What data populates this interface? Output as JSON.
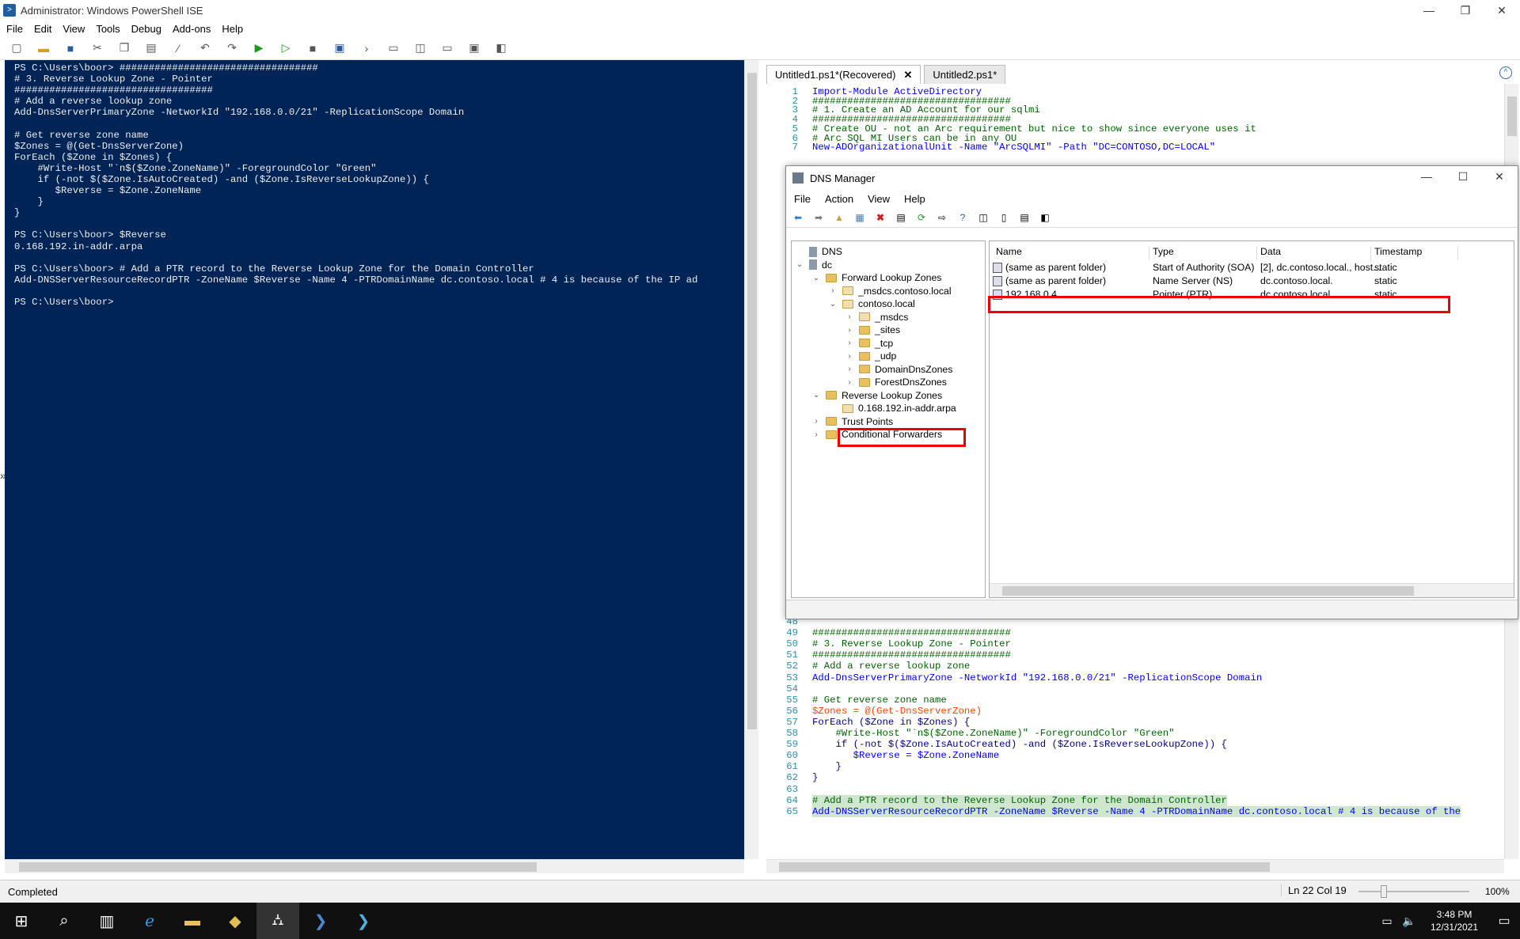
{
  "window": {
    "title": "Administrator: Windows PowerShell ISE",
    "minimize": "—",
    "restore": "❐",
    "close": "✕"
  },
  "menu": [
    "File",
    "Edit",
    "View",
    "Tools",
    "Debug",
    "Add-ons",
    "Help"
  ],
  "console": {
    "lines": [
      "PS C:\\Users\\boor> ##################################",
      "# 3. Reverse Lookup Zone - Pointer",
      "##################################",
      "# Add a reverse lookup zone",
      "Add-DnsServerPrimaryZone -NetworkId \"192.168.0.0/21\" -ReplicationScope Domain",
      "",
      "# Get reverse zone name",
      "$Zones = @(Get-DnsServerZone)",
      "ForEach ($Zone in $Zones) {",
      "    #Write-Host \"`n$($Zone.ZoneName)\" -ForegroundColor \"Green\"",
      "    if (-not $($Zone.IsAutoCreated) -and ($Zone.IsReverseLookupZone)) {",
      "       $Reverse = $Zone.ZoneName",
      "    }",
      "}",
      "",
      "PS C:\\Users\\boor> $Reverse",
      "0.168.192.in-addr.arpa",
      "",
      "PS C:\\Users\\boor> # Add a PTR record to the Reverse Lookup Zone for the Domain Controller",
      "Add-DNSServerResourceRecordPTR -ZoneName $Reverse -Name 4 -PTRDomainName dc.contoso.local # 4 is because of the IP ad",
      "",
      "PS C:\\Users\\boor>"
    ]
  },
  "tabs": [
    {
      "label": "Untitled1.ps1*(Recovered)",
      "close": "✕"
    },
    {
      "label": "Untitled2.ps1*"
    }
  ],
  "editor_top": [
    {
      "n": "1",
      "t": "Import-Module ActiveDirectory"
    },
    {
      "n": "2",
      "t": "##################################"
    },
    {
      "n": "3",
      "t": "# 1. Create an AD Account for our sqlmi"
    },
    {
      "n": "4",
      "t": "##################################"
    },
    {
      "n": "5",
      "t": "# Create OU - not an Arc requirement but nice to show since everyone uses it"
    },
    {
      "n": "6",
      "t": "# Arc SQL MI Users can be in any OU"
    },
    {
      "n": "7",
      "t": "New-ADOrganizationalUnit -Name \"ArcSQLMI\" -Path \"DC=CONTOSO,DC=LOCAL\""
    }
  ],
  "editor_bottom": [
    {
      "n": "48",
      "t": ""
    },
    {
      "n": "49",
      "t": "##################################"
    },
    {
      "n": "50",
      "t": "# 3. Reverse Lookup Zone - Pointer"
    },
    {
      "n": "51",
      "t": "##################################"
    },
    {
      "n": "52",
      "t": "# Add a reverse lookup zone"
    },
    {
      "n": "53",
      "t": "Add-DnsServerPrimaryZone -NetworkId \"192.168.0.0/21\" -ReplicationScope Domain"
    },
    {
      "n": "54",
      "t": ""
    },
    {
      "n": "55",
      "t": "# Get reverse zone name"
    },
    {
      "n": "56",
      "t": "$Zones = @(Get-DnsServerZone)"
    },
    {
      "n": "57",
      "t": "ForEach ($Zone in $Zones) {"
    },
    {
      "n": "58",
      "t": "    #Write-Host \"`n$($Zone.ZoneName)\" -ForegroundColor \"Green\""
    },
    {
      "n": "59",
      "t": "    if (-not $($Zone.IsAutoCreated) -and ($Zone.IsReverseLookupZone)) {"
    },
    {
      "n": "60",
      "t": "       $Reverse = $Zone.ZoneName"
    },
    {
      "n": "61",
      "t": "    }"
    },
    {
      "n": "62",
      "t": "}"
    },
    {
      "n": "63",
      "t": ""
    },
    {
      "n": "64",
      "t": "# Add a PTR record to the Reverse Lookup Zone for the Domain Controller"
    },
    {
      "n": "65",
      "t": "Add-DNSServerResourceRecordPTR -ZoneName $Reverse -Name 4 -PTRDomainName dc.contoso.local # 4 is because of the"
    }
  ],
  "dns": {
    "title": "DNS Manager",
    "menu": [
      "File",
      "Action",
      "View",
      "Help"
    ],
    "tree": [
      {
        "label": "DNS",
        "depth": 0,
        "chev": "",
        "icon": "dns"
      },
      {
        "label": "dc",
        "depth": 0,
        "chev": "v",
        "icon": "server"
      },
      {
        "label": "Forward Lookup Zones",
        "depth": 1,
        "chev": "v",
        "icon": "folder"
      },
      {
        "label": "_msdcs.contoso.local",
        "depth": 2,
        "chev": ">",
        "icon": "zone"
      },
      {
        "label": "contoso.local",
        "depth": 2,
        "chev": "v",
        "icon": "zone"
      },
      {
        "label": "_msdcs",
        "depth": 3,
        "chev": ">",
        "icon": "zone"
      },
      {
        "label": "_sites",
        "depth": 3,
        "chev": ">",
        "icon": "folder"
      },
      {
        "label": "_tcp",
        "depth": 3,
        "chev": ">",
        "icon": "folder"
      },
      {
        "label": "_udp",
        "depth": 3,
        "chev": ">",
        "icon": "folder"
      },
      {
        "label": "DomainDnsZones",
        "depth": 3,
        "chev": ">",
        "icon": "folder"
      },
      {
        "label": "ForestDnsZones",
        "depth": 3,
        "chev": ">",
        "icon": "folder"
      },
      {
        "label": "Reverse Lookup Zones",
        "depth": 1,
        "chev": "v",
        "icon": "folder"
      },
      {
        "label": "0.168.192.in-addr.arpa",
        "depth": 2,
        "chev": "",
        "icon": "zone"
      },
      {
        "label": "Trust Points",
        "depth": 1,
        "chev": ">",
        "icon": "folder"
      },
      {
        "label": "Conditional Forwarders",
        "depth": 1,
        "chev": ">",
        "icon": "folder"
      }
    ],
    "columns": [
      "Name",
      "Type",
      "Data",
      "Timestamp"
    ],
    "rows": [
      [
        "(same as parent folder)",
        "Start of Authority (SOA)",
        "[2], dc.contoso.local., host...",
        "static"
      ],
      [
        "(same as parent folder)",
        "Name Server (NS)",
        "dc.contoso.local.",
        "static"
      ],
      [
        "192.168.0.4",
        "Pointer (PTR)",
        "dc.contoso.local.",
        "static"
      ]
    ]
  },
  "status": {
    "text": "Completed",
    "position": "Ln 22  Col 19",
    "zoom": "100%"
  },
  "clock": {
    "time": "3:48 PM",
    "date": "12/31/2021"
  }
}
